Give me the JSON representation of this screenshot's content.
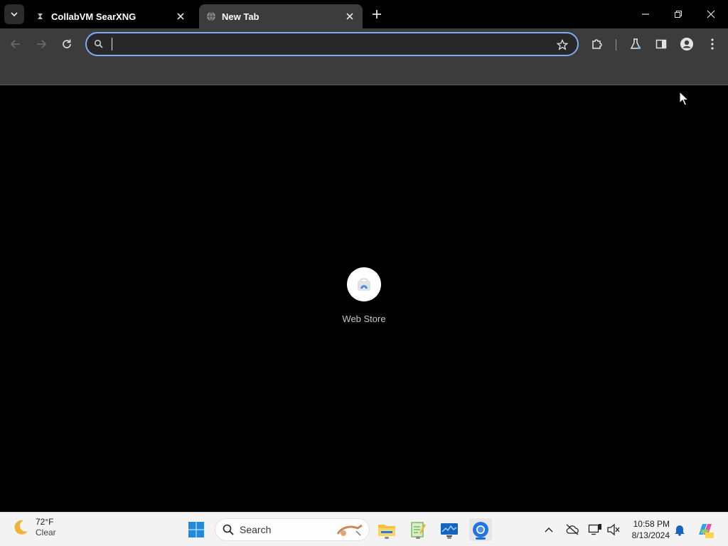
{
  "browser": {
    "tabs": [
      {
        "title": "CollabVM SearXNG",
        "active": false
      },
      {
        "title": "New Tab",
        "active": true
      }
    ],
    "omnibox": {
      "value": "",
      "placeholder": ""
    },
    "shortcuts": [
      {
        "label": "Web Store"
      }
    ],
    "colors": {
      "accent": "#7cacf8",
      "toolbar": "#3c3c3c",
      "background": "#000000"
    }
  },
  "taskbar": {
    "weather": {
      "temperature": "72°F",
      "condition": "Clear"
    },
    "search_label": "Search",
    "clock": {
      "time": "10:58 PM",
      "date": "8/13/2024"
    },
    "apps": [
      "file-explorer-icon",
      "notepad-icon",
      "monitor-app-icon",
      "chrome-icon"
    ]
  }
}
